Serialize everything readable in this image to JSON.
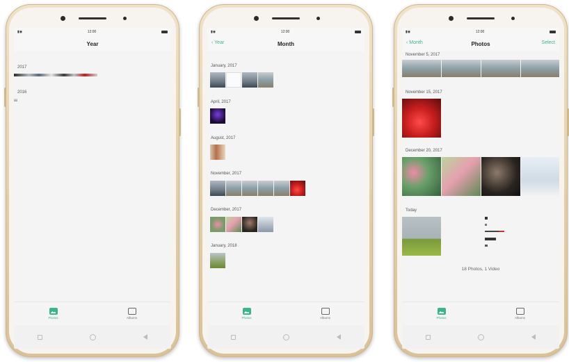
{
  "phones": [
    {
      "status_time": "12:00",
      "nav": {
        "back": "",
        "title": "Year",
        "right": ""
      },
      "groups": [
        {
          "label": "2017"
        },
        {
          "label": "2016"
        }
      ],
      "tabs": [
        {
          "label": "Photos"
        },
        {
          "label": "Albums"
        }
      ]
    },
    {
      "status_time": "12:00",
      "nav": {
        "back": "Year",
        "title": "Month",
        "right": ""
      },
      "groups": [
        {
          "label": "January, 2017"
        },
        {
          "label": "April, 2017"
        },
        {
          "label": "August, 2017"
        },
        {
          "label": "November, 2017"
        },
        {
          "label": "December, 2017"
        },
        {
          "label": "January, 2018"
        }
      ],
      "tabs": [
        {
          "label": "Photos"
        },
        {
          "label": "Albums"
        }
      ]
    },
    {
      "status_time": "12:00",
      "nav": {
        "back": "Month",
        "title": "Photos",
        "right": "Select"
      },
      "groups": [
        {
          "label": "November 5, 2017"
        },
        {
          "label": "November 15, 2017"
        },
        {
          "label": "December 20, 2017"
        },
        {
          "label": "Today"
        }
      ],
      "footer": "18 Photos, 1 Video",
      "tabs": [
        {
          "label": "Photos"
        },
        {
          "label": "Albums"
        }
      ]
    }
  ],
  "colors": {
    "accent": "#3cb48c",
    "screen_bg": "#f4f4f4",
    "frame": "#e2cfaa"
  }
}
